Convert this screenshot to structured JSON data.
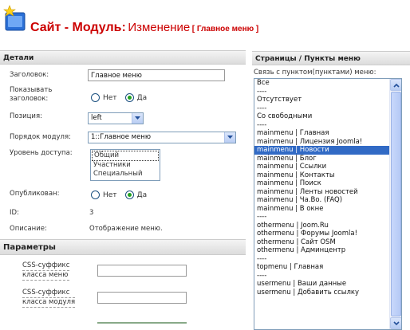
{
  "header": {
    "title_main": "Сайт - Модуль:",
    "title_action": "Изменение",
    "title_sub": "[ Главное меню ]"
  },
  "details": {
    "heading": "Детали",
    "title_label": "Заголовок:",
    "title_value": "Главное меню",
    "show_title_label": "Показывать заголовок:",
    "show_title_options": [
      "Нет",
      "Да"
    ],
    "show_title_selected": "Да",
    "position_label": "Позиция:",
    "position_value": "left",
    "order_label": "Порядок модуля:",
    "order_value": "1::Главное меню",
    "access_label": "Уровень доступа:",
    "access_options": [
      "Общий",
      "Участники",
      "Специальный"
    ],
    "access_selected": "Общий",
    "published_label": "Опубликован:",
    "published_options": [
      "Нет",
      "Да"
    ],
    "published_selected": "Да",
    "id_label": "ID:",
    "id_value": "3",
    "description_label": "Описание:",
    "description_value": "Отображение меню."
  },
  "params": {
    "heading": "Параметры",
    "menu_suffix_label_1": "CSS-суффикс",
    "menu_suffix_label_2": "класса меню",
    "module_suffix_label_1": "CSS-суффикс",
    "module_suffix_label_2": "класса модуля",
    "menu_suffix_value": "",
    "module_suffix_value": ""
  },
  "pages": {
    "heading": "Страницы / Пункты меню",
    "link_label": "Связь с пунктом(пунктами) меню:",
    "items": [
      "Все",
      "----",
      "Отсутствует",
      "----",
      "Со свободными",
      "----",
      "mainmenu | Главная",
      "mainmenu | Лицензия Joomla!",
      "mainmenu | Новости",
      "mainmenu | Блог",
      "mainmenu | Ссылки",
      "mainmenu | Контакты",
      "mainmenu | Поиск",
      "mainmenu | Ленты новостей",
      "mainmenu | Ча.Во. (FAQ)",
      "mainmenu | В окне",
      "----",
      "othermenu | Joom.Ru",
      "othermenu | Форумы Joomla!",
      "othermenu | Сайт OSM",
      "othermenu | Админцентр",
      "----",
      "topmenu | Главная",
      "----",
      "usermenu | Ваши данные",
      "usermenu | Добавить ссылку"
    ],
    "selected_item": "mainmenu | Новости"
  },
  "colors": {
    "accent_red": "#cc0000",
    "selection_blue": "#316ac5"
  }
}
